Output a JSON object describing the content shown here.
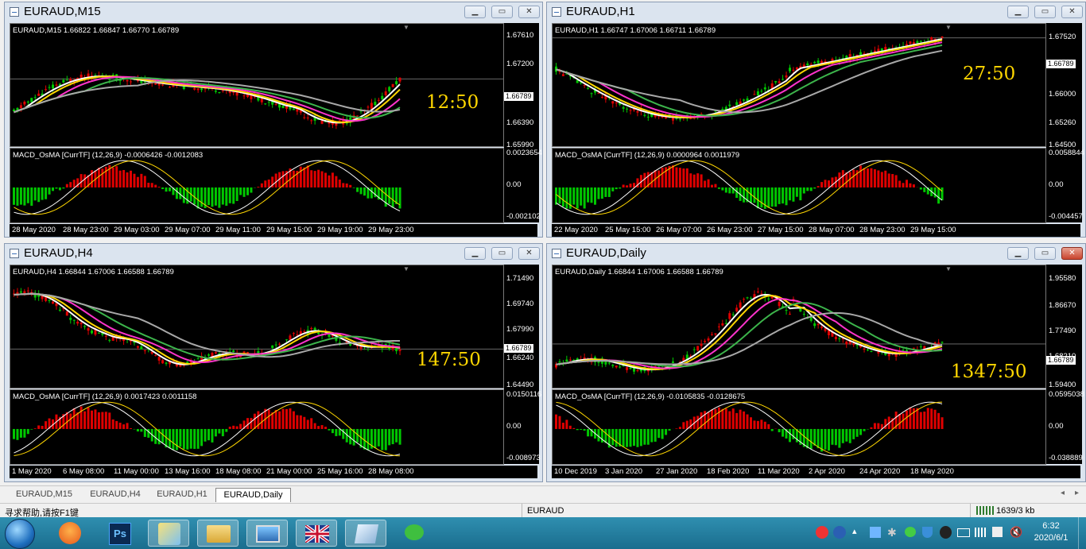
{
  "windows": [
    {
      "title": "EURAUD,M15",
      "info": "EURAUD,M15  1.66822 1.66847 1.66770 1.66789",
      "price_box": "1.66789",
      "timer": "12:50",
      "price_ticks": [
        "1.67610",
        "1.67200",
        "1.66789",
        "1.66390",
        "1.65990"
      ],
      "macd_info": "MACD_OsMA [CurrTF] (12,26,9) -0.0006426 -0.0012083",
      "macd_ticks": [
        "0.0023654",
        "0.00",
        "-0.002102"
      ],
      "time_ticks": [
        "28 May 2020",
        "28 May 23:00",
        "29 May 03:00",
        "29 May 07:00",
        "29 May 11:00",
        "29 May 15:00",
        "29 May 19:00",
        "29 May 23:00"
      ]
    },
    {
      "title": "EURAUD,H1",
      "info": "EURAUD,H1  1.66747 1.67006 1.66711 1.66789",
      "price_box": "1.66789",
      "timer": "27:50",
      "price_ticks": [
        "1.67520",
        "1.66789",
        "1.66000",
        "1.65260",
        "1.64500"
      ],
      "macd_info": "MACD_OsMA [CurrTF] (12,26,9) 0.0000964 0.0011979",
      "macd_ticks": [
        "0.0058844",
        "0.00",
        "-0.004457"
      ],
      "time_ticks": [
        "22 May 2020",
        "25 May 15:00",
        "26 May 07:00",
        "26 May 23:00",
        "27 May 15:00",
        "28 May 07:00",
        "28 May 23:00",
        "29 May 15:00"
      ]
    },
    {
      "title": "EURAUD,H4",
      "info": "EURAUD,H4  1.66844 1.67006 1.66588 1.66789",
      "price_box": "1.66789",
      "timer": "147:50",
      "price_ticks": [
        "1.71490",
        "1.69740",
        "1.67990",
        "1.66789",
        "1.66240",
        "1.64490"
      ],
      "macd_info": "MACD_OsMA [CurrTF] (12,26,9) 0.0017423 0.0011158",
      "macd_ticks": [
        "0.0150116",
        "0.00",
        "-0.008973"
      ],
      "time_ticks": [
        "1 May 2020",
        "6 May 08:00",
        "11 May 00:00",
        "13 May 16:00",
        "18 May 08:00",
        "21 May 00:00",
        "25 May 16:00",
        "28 May 08:00"
      ]
    },
    {
      "title": "EURAUD,Daily",
      "info": "EURAUD,Daily  1.66844 1.67006 1.66588 1.66789",
      "price_box": "1.66789",
      "timer": "1347:50",
      "price_ticks": [
        "1.95580",
        "1.86670",
        "1.77490",
        "1.68210",
        "1.66789",
        "1.59400"
      ],
      "macd_info": "MACD_OsMA [CurrTF] (12,26,9) -0.0105835 -0.0128675",
      "macd_ticks": [
        "0.0595038",
        "0.00",
        "-0.038889"
      ],
      "time_ticks": [
        "10 Dec 2019",
        "3 Jan 2020",
        "27 Jan 2020",
        "18 Feb 2020",
        "11 Mar 2020",
        "2 Apr 2020",
        "24 Apr 2020",
        "18 May 2020"
      ]
    }
  ],
  "tabs": [
    "EURAUD,M15",
    "EURAUD,H4",
    "EURAUD,H1",
    "EURAUD,Daily"
  ],
  "active_tab": "EURAUD,Daily",
  "status": {
    "help": "寻求帮助,请按F1键",
    "profile": "EURAUD",
    "traffic": "1639/3 kb"
  },
  "clock": {
    "time": "6:32",
    "date": "2020/6/1"
  },
  "taskbar_apps": [
    "start-orb",
    "fox-app",
    "photoshop-app",
    "paint-app",
    "file-explorer-app",
    "photo-viewer-app",
    "uk-flag-app",
    "notebook-app",
    "wechat-app"
  ],
  "colors": {
    "white": "#ffffff",
    "yellow": "#ffd700",
    "magenta": "#ff33cc",
    "green": "#3cb44b",
    "gray": "#a8a8a8",
    "bull": "#00c800",
    "bear": "#e00000"
  }
}
